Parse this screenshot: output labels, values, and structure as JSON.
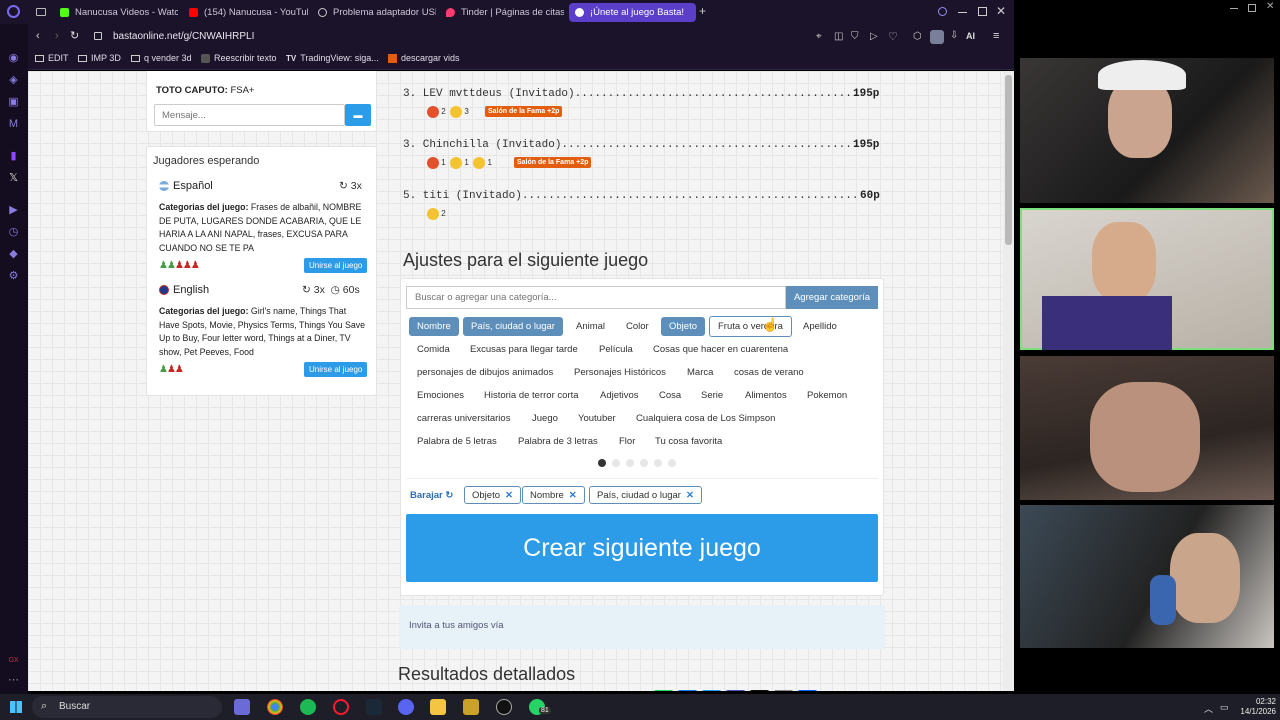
{
  "browser": {
    "tabs": [
      {
        "label": "Nanucusa Videos - Watch",
        "color": "#53fc18"
      },
      {
        "label": "(154) Nanucusa - YouTube",
        "color": "#ff0000"
      },
      {
        "label": "Problema adaptador USB...",
        "color": "#cccccc"
      },
      {
        "label": "Tinder | Páginas de citas",
        "color": "#fe3c72"
      },
      {
        "label": "¡Únete al juego Basta!",
        "color": "#7a6af0"
      }
    ],
    "url": "bastaonline.net/g/CNWAIHRPLI",
    "ai_label": "AI",
    "bookmarks": [
      "EDIT",
      "IMP 3D",
      "q vender 3d",
      "Reescribir texto",
      "TradingView: siga...",
      "descargar vids"
    ]
  },
  "chat": {
    "last_user": "TOTO CAPUTO:",
    "last_message": "FSA+",
    "placeholder": "Mensaje..."
  },
  "waiting": {
    "title": "Jugadores esperando",
    "games": [
      {
        "lang": "Español",
        "rounds": "3x",
        "timer": "",
        "cat_label": "Categorias del juego:",
        "categories": "Frases de albañil, NOMBRE DE PUTA, LUGARES DONDE ACABARIA, QUE LE HARIA A LA ANI NAPAL, frases, EXCUSA PARA CUANDO NO SE TE PA",
        "join": "Unirse al juego"
      },
      {
        "lang": "English",
        "rounds": "3x",
        "timer": "60s",
        "cat_label": "Categorias del juego:",
        "categories": "Girl's name, Things That Have Spots, Movie, Physics Terms, Things You Save Up to Buy, Four letter word, Things at a Diner, TV show, Pet Peeves, Food",
        "join": "Unirse al juego"
      }
    ]
  },
  "scores": [
    {
      "line": "3. LEV mvttdeus (Invitado)...........................................",
      "points": "195p",
      "reactions": [
        "2",
        "3"
      ],
      "fame": "Salón de la Fama +2p"
    },
    {
      "line": "3. Chinchilla (Invitado).............................................",
      "points": "195p",
      "reactions": [
        "1",
        "1",
        "1"
      ],
      "fame": "Salón de la Fama +2p"
    },
    {
      "line": "5. titi (Invitado)...................................................",
      "points": "60p",
      "reactions": [
        "2"
      ],
      "fame": ""
    }
  ],
  "settings": {
    "title": "Ajustes para el siguiente juego",
    "search_placeholder": "Buscar o agregar una categoría...",
    "add_label": "Agregar categoría",
    "categories": [
      [
        "Nombre",
        "País, ciudad o lugar",
        "Animal",
        "Color",
        "Objeto",
        "Fruta o verdura",
        "Apellido"
      ],
      [
        "Comida",
        "Excusas para llegar tarde",
        "Película",
        "Cosas que hacer en cuarentena"
      ],
      [
        "personajes de dibujos animados",
        "Personajes Históricos",
        "Marca",
        "cosas de verano"
      ],
      [
        "Emociones",
        "Historia de terror corta",
        "Adjetivos",
        "Cosa",
        "Serie",
        "Alimentos",
        "Pokemon"
      ],
      [
        "carreras universitarios",
        "Juego",
        "Youtuber",
        "Cualquiera cosa de Los Simpson"
      ],
      [
        "Palabra de 5 letras",
        "Palabra de 3 letras",
        "Flor",
        "Tu cosa favorita"
      ]
    ],
    "shuffle": "Barajar",
    "selected": [
      "Objeto",
      "Nombre",
      "País, ciudad o lugar"
    ],
    "create": "Crear siguiente juego"
  },
  "invite": {
    "text": "Invita a tus amigos vía"
  },
  "results_title": "Resultados detallados",
  "taskbar": {
    "search": "Buscar",
    "time": "02:32",
    "date": "14/1/2026",
    "badge": "81"
  }
}
